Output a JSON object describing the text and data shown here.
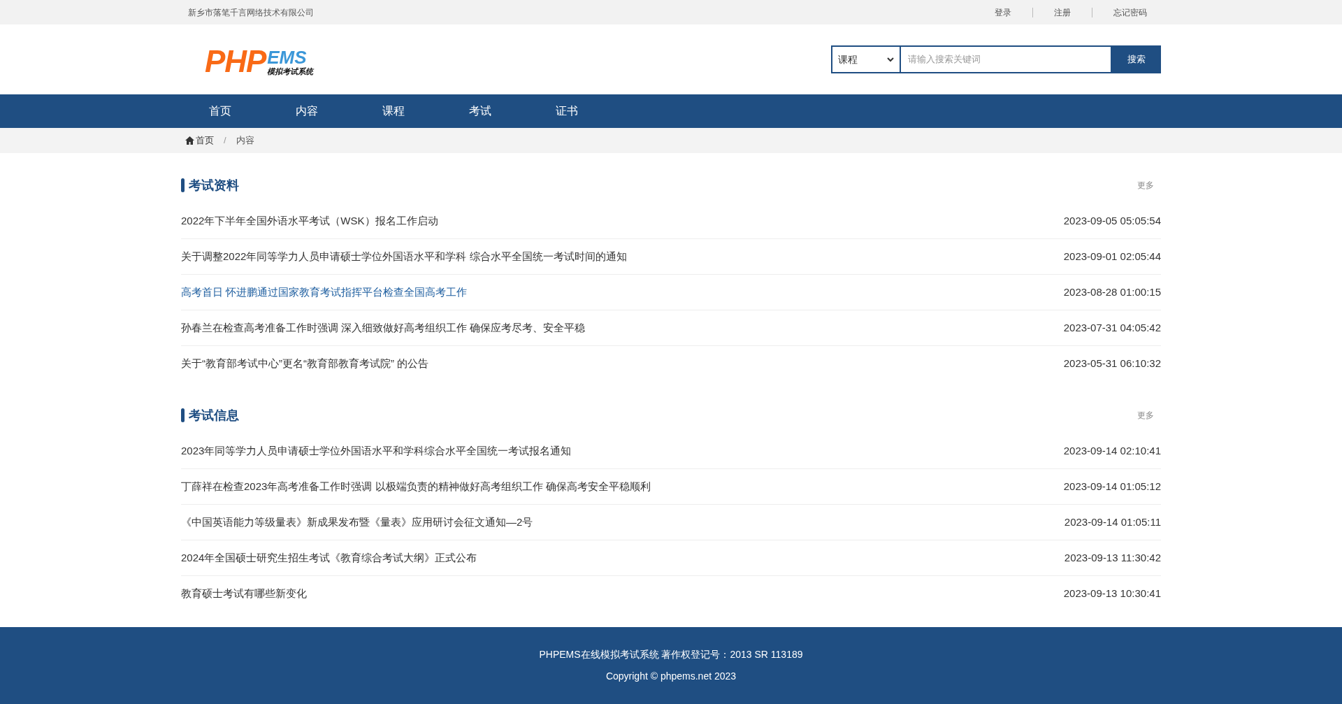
{
  "top_bar": {
    "company": "新乡市落笔千言网络技术有限公司",
    "links": [
      "登录",
      "注册",
      "忘记密码"
    ]
  },
  "logo": {
    "main": "PHP",
    "accent": "EMS",
    "subtitle": "模拟考试系统"
  },
  "search": {
    "category": "课程",
    "placeholder": "请输入搜索关键词",
    "button": "搜索"
  },
  "nav": [
    "首页",
    "内容",
    "课程",
    "考试",
    "证书"
  ],
  "breadcrumb": {
    "separator": "/",
    "items": [
      "首页",
      "内容"
    ]
  },
  "sections": [
    {
      "title": "考试资料",
      "more": "更多",
      "items": [
        {
          "title": "2022年下半年全国外语水平考试（WSK）报名工作启动",
          "date": "2023-09-05 05:05:54",
          "highlighted": false
        },
        {
          "title": "关于调整2022年同等学力人员申请硕士学位外国语水平和学科 综合水平全国统一考试时间的通知",
          "date": "2023-09-01 02:05:44",
          "highlighted": false
        },
        {
          "title": "高考首日 怀进鹏通过国家教育考试指挥平台检查全国高考工作",
          "date": "2023-08-28 01:00:15",
          "highlighted": true
        },
        {
          "title": "孙春兰在检查高考准备工作时强调 深入细致做好高考组织工作 确保应考尽考、安全平稳",
          "date": "2023-07-31 04:05:42",
          "highlighted": false
        },
        {
          "title": "关于“教育部考试中心”更名“教育部教育考试院” 的公告",
          "date": "2023-05-31 06:10:32",
          "highlighted": false
        }
      ]
    },
    {
      "title": "考试信息",
      "more": "更多",
      "items": [
        {
          "title": "2023年同等学力人员申请硕士学位外国语水平和学科综合水平全国统一考试报名通知",
          "date": "2023-09-14 02:10:41",
          "highlighted": false
        },
        {
          "title": "丁薛祥在检查2023年高考准备工作时强调 以极端负责的精神做好高考组织工作 确保高考安全平稳顺利",
          "date": "2023-09-14 01:05:12",
          "highlighted": false
        },
        {
          "title": "《中国英语能力等级量表》新成果发布暨《量表》应用研讨会征文通知—2号",
          "date": "2023-09-14 01:05:11",
          "highlighted": false
        },
        {
          "title": "2024年全国硕士研究生招生考试《教育综合考试大纲》正式公布",
          "date": "2023-09-13 11:30:42",
          "highlighted": false
        },
        {
          "title": "教育硕士考试有哪些新变化",
          "date": "2023-09-13 10:30:41",
          "highlighted": false
        }
      ]
    }
  ],
  "footer": [
    "PHPEMS在线模拟考试系统 著作权登记号：2013 SR 113189",
    "Copyright © phpems.net 2023"
  ]
}
